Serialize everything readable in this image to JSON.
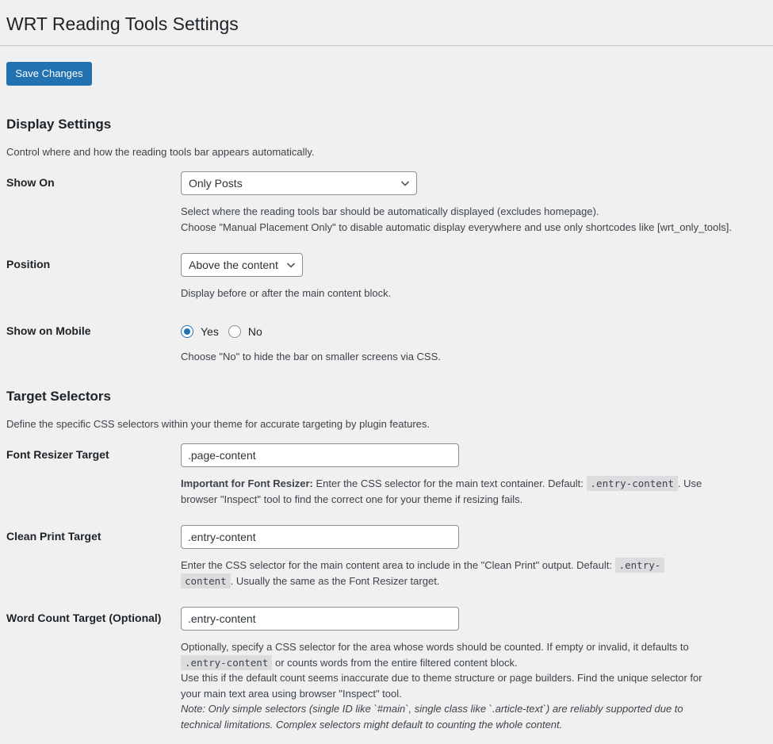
{
  "page": {
    "title": "WRT Reading Tools Settings"
  },
  "toolbar": {
    "save_label": "Save Changes"
  },
  "display": {
    "heading": "Display Settings",
    "description": "Control where and how the reading tools bar appears automatically.",
    "show_on": {
      "label": "Show On",
      "value": "Only Posts",
      "desc_line1": "Select where the reading tools bar should be automatically displayed (excludes homepage).",
      "desc_line2": "Choose \"Manual Placement Only\" to disable automatic display everywhere and use only shortcodes like [wrt_only_tools]."
    },
    "position": {
      "label": "Position",
      "value": "Above the content",
      "desc": "Display before or after the main content block."
    },
    "mobile": {
      "label": "Show on Mobile",
      "options": [
        "Yes",
        "No"
      ],
      "selected": "Yes",
      "desc": "Choose \"No\" to hide the bar on smaller screens via CSS."
    }
  },
  "selectors": {
    "heading": "Target Selectors",
    "description": "Define the specific CSS selectors within your theme for accurate targeting by plugin features.",
    "font_resizer": {
      "label": "Font Resizer Target",
      "value": ".page-content",
      "desc_strong": "Important for Font Resizer:",
      "desc_a": " Enter the CSS selector for the main text container. Default: ",
      "desc_code": ".entry-content",
      "desc_b": ". Use",
      "desc_line2": "browser \"Inspect\" tool to find the correct one for your theme if resizing fails."
    },
    "clean_print": {
      "label": "Clean Print Target",
      "value": ".entry-content",
      "desc_a": "Enter the CSS selector for the main content area to include in the \"Clean Print\" output. Default: ",
      "desc_code1": ".entry-",
      "desc_code2": "content",
      "desc_b": ". Usually the same as the Font Resizer target."
    },
    "word_count": {
      "label": "Word Count Target (Optional)",
      "value": ".entry-content",
      "desc_line1": "Optionally, specify a CSS selector for the area whose words should be counted. If empty or invalid, it defaults to",
      "desc_code": ".entry-content",
      "desc_line2b": " or counts words from the entire filtered content block.",
      "desc_line3": "Use this if the default count seems inaccurate due to theme structure or page builders. Find the unique selector for",
      "desc_line4": "your main text area using browser \"Inspect\" tool.",
      "note_line1": "Note: Only simple selectors (single ID like `#main`, single class like `.article-text`) are reliably supported due to",
      "note_line2": "technical limitations. Complex selectors might default to counting the whole content."
    }
  }
}
